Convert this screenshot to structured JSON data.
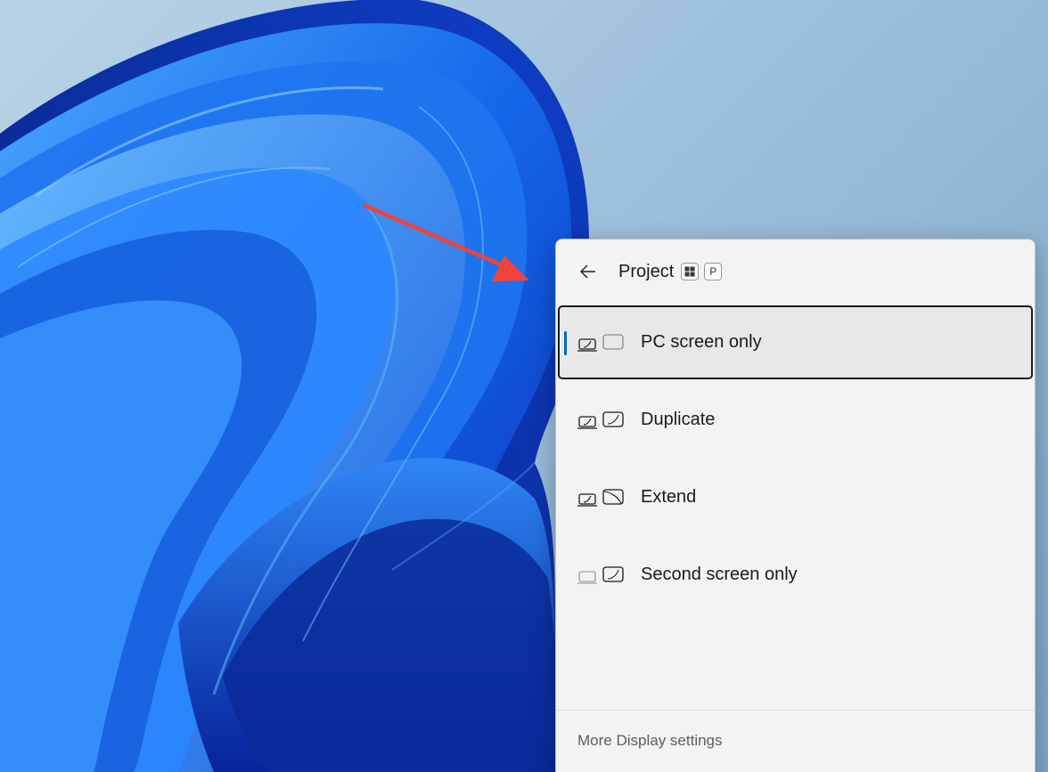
{
  "colors": {
    "accent": "#0067c0",
    "arrow": "#f0433a",
    "panel_background": "#f3f3f3"
  },
  "project_panel": {
    "back_icon": "arrow-left-icon",
    "title": "Project",
    "shortcut_keys": [
      {
        "icon": "windows-key-icon",
        "label": ""
      },
      {
        "icon": "p-key",
        "label": "P"
      }
    ],
    "options": [
      {
        "label": "PC screen only",
        "icon": "pc-screen-only-icon",
        "selected": true
      },
      {
        "label": "Duplicate",
        "icon": "duplicate-icon",
        "selected": false
      },
      {
        "label": "Extend",
        "icon": "extend-icon",
        "selected": false
      },
      {
        "label": "Second screen only",
        "icon": "second-screen-only-icon",
        "selected": false
      }
    ],
    "footer_link": "More Display settings"
  },
  "annotation": {
    "icon": "red-arrow-icon"
  }
}
